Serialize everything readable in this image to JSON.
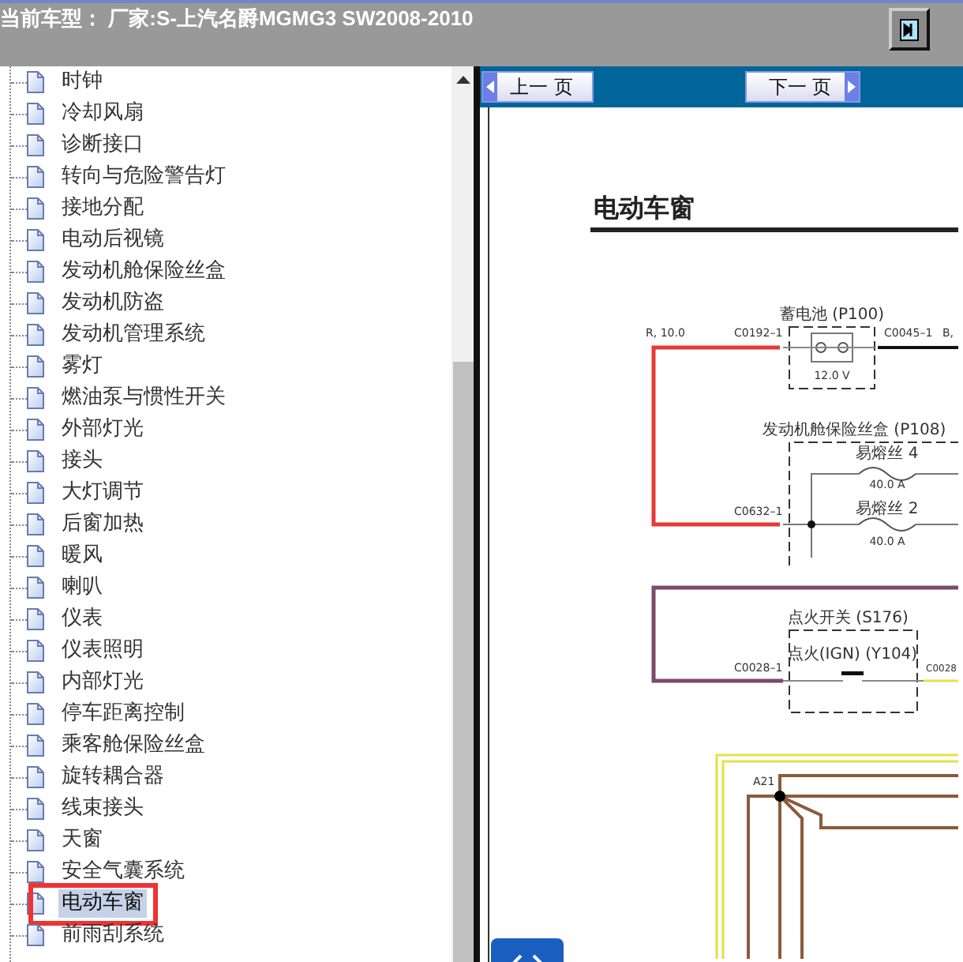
{
  "header": {
    "title": "当前车型：  厂家:S-上汽名爵MGMG3 SW2008-2010"
  },
  "tree": {
    "items": [
      {
        "label": "时钟",
        "selected": false
      },
      {
        "label": "冷却风扇",
        "selected": false
      },
      {
        "label": "诊断接口",
        "selected": false
      },
      {
        "label": "转向与危险警告灯",
        "selected": false
      },
      {
        "label": "接地分配",
        "selected": false
      },
      {
        "label": "电动后视镜",
        "selected": false
      },
      {
        "label": "发动机舱保险丝盒",
        "selected": false
      },
      {
        "label": "发动机防盗",
        "selected": false
      },
      {
        "label": "发动机管理系统",
        "selected": false
      },
      {
        "label": "雾灯",
        "selected": false
      },
      {
        "label": "燃油泵与惯性开关",
        "selected": false
      },
      {
        "label": "外部灯光",
        "selected": false
      },
      {
        "label": "接头",
        "selected": false
      },
      {
        "label": "大灯调节",
        "selected": false
      },
      {
        "label": "后窗加热",
        "selected": false
      },
      {
        "label": "暖风",
        "selected": false
      },
      {
        "label": "喇叭",
        "selected": false
      },
      {
        "label": "仪表",
        "selected": false
      },
      {
        "label": "仪表照明",
        "selected": false
      },
      {
        "label": "内部灯光",
        "selected": false
      },
      {
        "label": "停车距离控制",
        "selected": false
      },
      {
        "label": "乘客舱保险丝盒",
        "selected": false
      },
      {
        "label": "旋转耦合器",
        "selected": false
      },
      {
        "label": "线束接头",
        "selected": false
      },
      {
        "label": "天窗",
        "selected": false
      },
      {
        "label": "安全气囊系统",
        "selected": false
      },
      {
        "label": "电动车窗",
        "selected": true
      },
      {
        "label": "前雨刮系统",
        "selected": false
      }
    ]
  },
  "viewer": {
    "buttons": [
      {
        "label": "上一 页",
        "kind": "prev"
      },
      {
        "label": "下一 页",
        "kind": "next"
      }
    ],
    "document": {
      "title": "电动车窗",
      "labels": [
        "R, 10.0",
        "C0192–1",
        "蓄电池 (P100)",
        "12.0 V",
        "C0045–1",
        "B,",
        "发动机舱保险丝盒 (P108)",
        "易熔丝 4",
        "40.0 A",
        "易熔丝 2",
        "40.0 A",
        "C0632–1",
        "点火开关 (S176)",
        "点火(IGN) (Y104)",
        "C0028–1",
        "C0028",
        "A21"
      ]
    }
  }
}
